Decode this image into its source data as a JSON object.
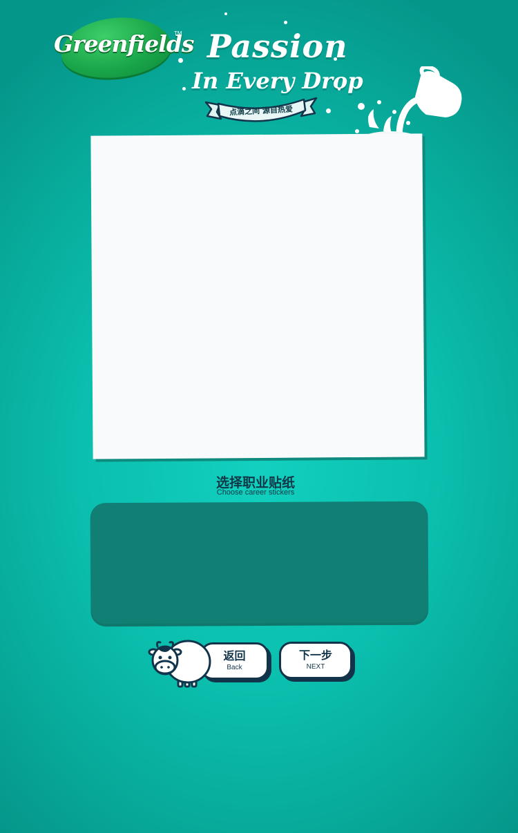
{
  "brand": {
    "logo_text": "Greenfields",
    "trademark": "TM"
  },
  "hero": {
    "title_line1": "Passion",
    "title_line2": "In Every Drop",
    "ribbon_text": "点滴之间  源自热爱"
  },
  "section": {
    "title_cn": "选择职业贴纸",
    "title_en": "Choose career stickers"
  },
  "buttons": {
    "back_cn": "返回",
    "back_en": "Back",
    "next_cn": "下一步",
    "next_en": "NEXT"
  },
  "icons": {
    "mascot": "cow-icon",
    "decoration": "milk-jug-icon"
  },
  "colors": {
    "background": "#0bbfae",
    "accent_dark": "#12344a",
    "panel": "#117f74",
    "logo_green": "#1aa64a"
  }
}
